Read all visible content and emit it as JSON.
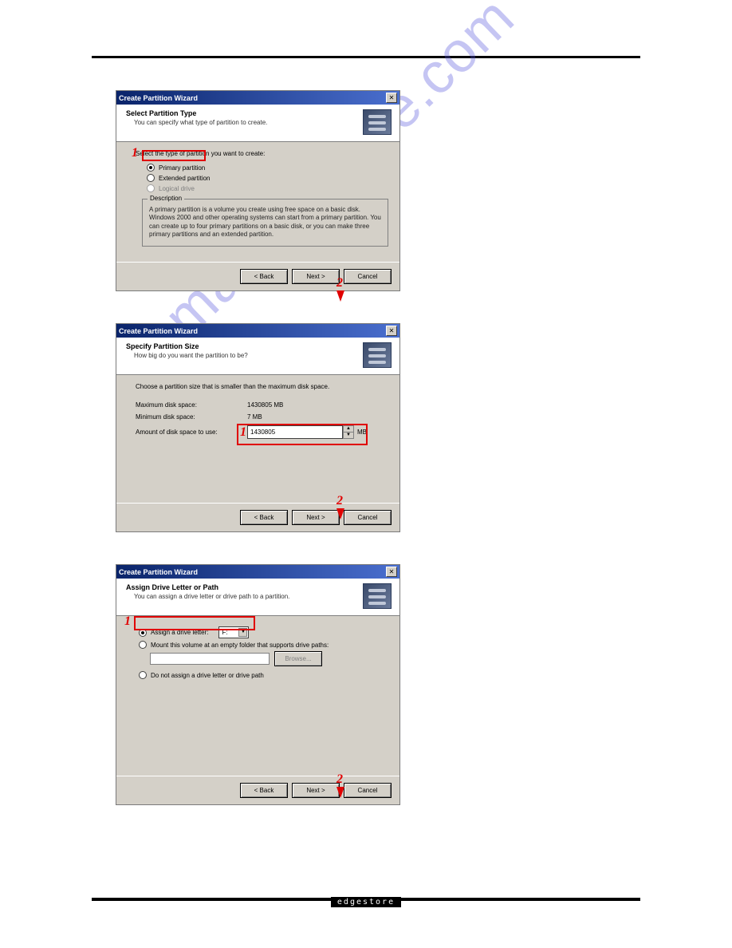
{
  "watermark": "manualshive.com",
  "footer_brand": "edgestore",
  "dialog_title": "Create Partition Wizard",
  "close_glyph": "✕",
  "buttons": {
    "back": "< Back",
    "next": "Next >",
    "cancel": "Cancel",
    "browse": "Browse..."
  },
  "callouts": {
    "one": "1",
    "two": "2"
  },
  "d1": {
    "title": "Select Partition Type",
    "subtitle": "You can specify what type of partition to create.",
    "intro": "Select the type of partition you want to create:",
    "opt_primary": "Primary partition",
    "opt_extended": "Extended partition",
    "opt_logical": "Logical drive",
    "desc_legend": "Description",
    "desc_text": "A primary partition is a volume you create using free space on a basic disk. Windows 2000 and other operating systems can start from a primary partition. You can create up to four primary partitions on a basic disk, or you can make three primary partitions and an extended partition."
  },
  "d2": {
    "title": "Specify Partition Size",
    "subtitle": "How big do you want the partition to be?",
    "intro": "Choose a partition size that is smaller than the maximum disk space.",
    "max_label": "Maximum disk space:",
    "max_value": "1430805 MB",
    "min_label": "Minimum disk space:",
    "min_value": "7 MB",
    "amount_label": "Amount of disk space to use:",
    "amount_value": "1430805",
    "mb": "MB"
  },
  "d3": {
    "title": "Assign Drive Letter or Path",
    "subtitle": "You can assign a drive letter or drive path to a partition.",
    "opt_assign": "Assign a drive letter:",
    "drive_letter": "F:",
    "opt_mount": "Mount this volume at an empty folder that supports drive paths:",
    "opt_none": "Do not assign a drive letter or drive path"
  }
}
